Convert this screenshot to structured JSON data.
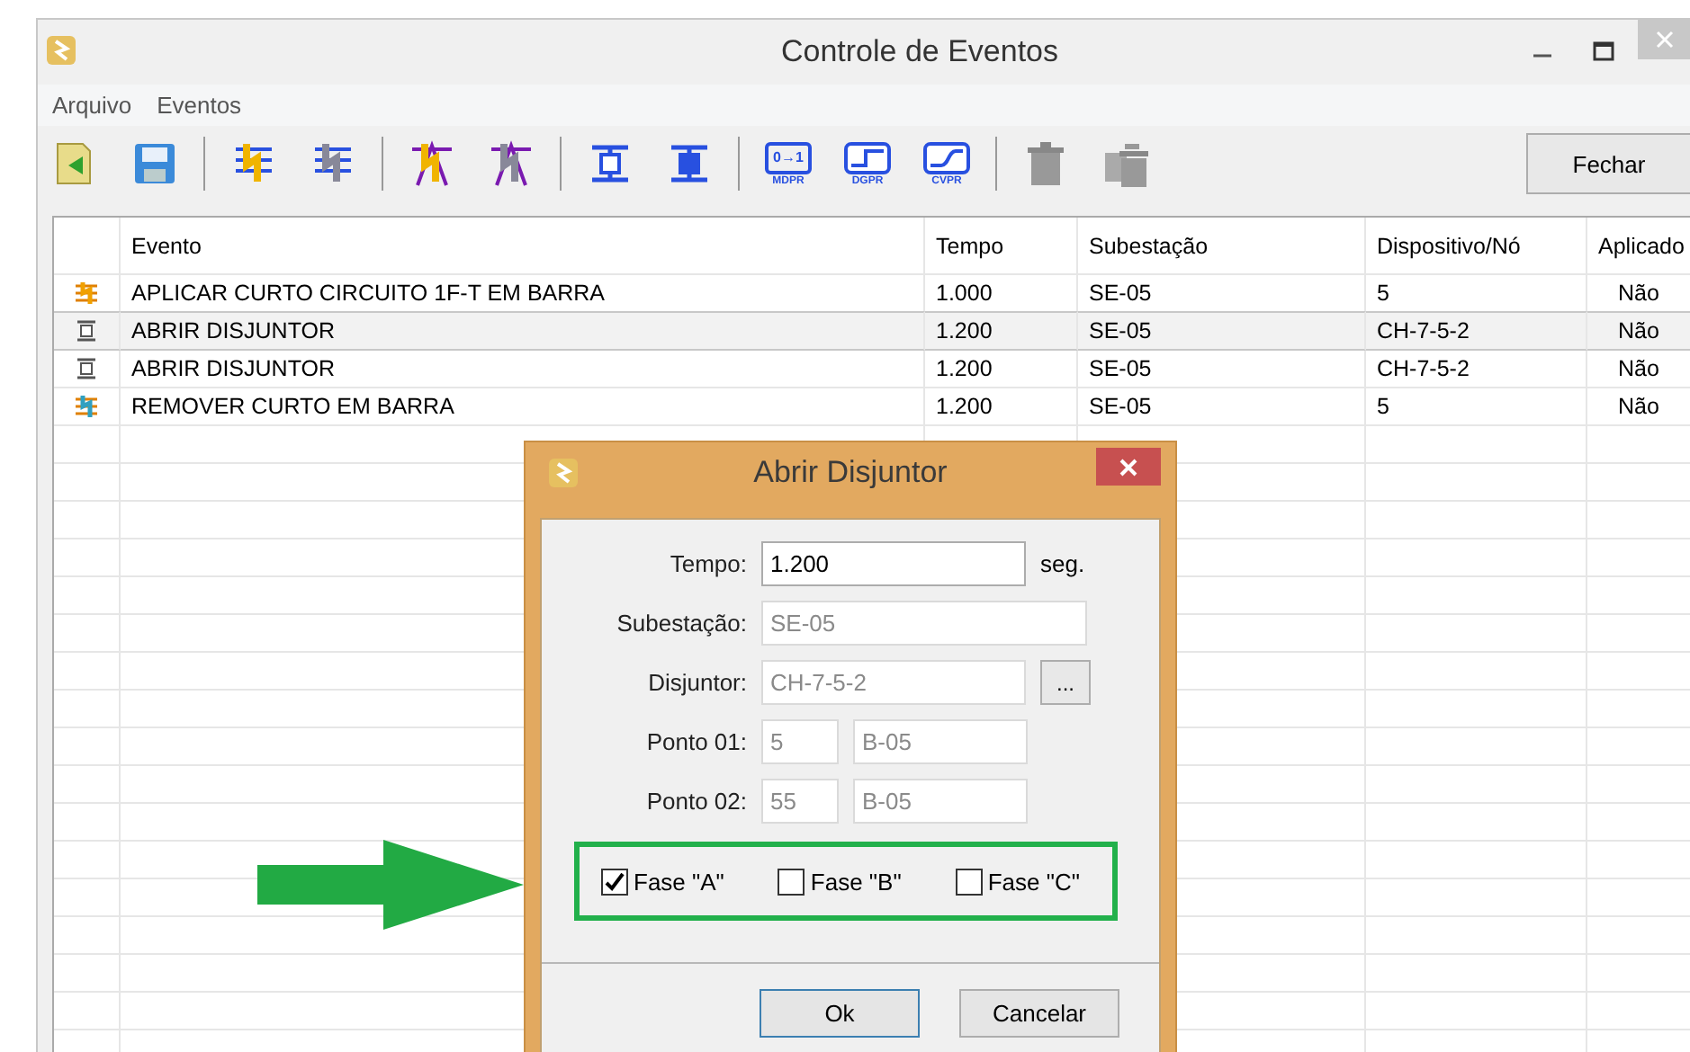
{
  "window": {
    "title": "Controle de Eventos"
  },
  "menu": [
    {
      "label": "Arquivo"
    },
    {
      "label": "Eventos"
    }
  ],
  "toolbar": [
    {
      "kind": "open"
    },
    {
      "kind": "save"
    },
    {
      "kind": "sep"
    },
    {
      "kind": "fault-list"
    },
    {
      "kind": "fault-list-gray"
    },
    {
      "kind": "sep"
    },
    {
      "kind": "tower"
    },
    {
      "kind": "tower-gray"
    },
    {
      "kind": "sep"
    },
    {
      "kind": "breaker"
    },
    {
      "kind": "breaker-blue"
    },
    {
      "kind": "sep"
    },
    {
      "kind": "relay",
      "glyph": "0→1",
      "caption": "MDPR"
    },
    {
      "kind": "step",
      "caption": "DGPR"
    },
    {
      "kind": "curve",
      "caption": "CVPR"
    },
    {
      "kind": "sep"
    },
    {
      "kind": "trash"
    },
    {
      "kind": "trash-many"
    }
  ],
  "close_button": "Fechar",
  "table": {
    "columns": [
      "Evento",
      "Tempo",
      "Subestação",
      "Dispositivo/Nó",
      "Aplicado"
    ],
    "rows": [
      {
        "kind": "fault-apply",
        "selected": false,
        "cells": [
          "APLICAR CURTO CIRCUITO 1F-T EM BARRA",
          "1.000",
          "SE-05",
          "5",
          "Não"
        ]
      },
      {
        "kind": "breaker",
        "selected": true,
        "cells": [
          "ABRIR DISJUNTOR",
          "1.200",
          "SE-05",
          "CH-7-5-2",
          "Não"
        ]
      },
      {
        "kind": "breaker",
        "selected": false,
        "cells": [
          "ABRIR DISJUNTOR",
          "1.200",
          "SE-05",
          "CH-7-5-2",
          "Não"
        ]
      },
      {
        "kind": "fault-remove",
        "selected": false,
        "cells": [
          "REMOVER CURTO EM BARRA",
          "1.200",
          "SE-05",
          "5",
          "Não"
        ]
      }
    ]
  },
  "dialog": {
    "title": "Abrir Disjuntor",
    "fields": [
      {
        "label": "Tempo:",
        "kind": "unit",
        "disabled": false,
        "values": [
          "1.200"
        ],
        "unit": "seg."
      },
      {
        "label": "Subestação:",
        "kind": "wide",
        "disabled": true,
        "values": [
          "SE-05"
        ]
      },
      {
        "label": "Disjuntor:",
        "kind": "browse",
        "disabled": true,
        "values": [
          "CH-7-5-2"
        ],
        "button": "..."
      },
      {
        "label": "Ponto 01:",
        "kind": "pair",
        "disabled": true,
        "values": [
          "5",
          "B-05"
        ]
      },
      {
        "label": "Ponto 02:",
        "kind": "pair",
        "disabled": true,
        "values": [
          "55",
          "B-05"
        ]
      }
    ],
    "phases": [
      {
        "label": "Fase \"A\"",
        "checked": true
      },
      {
        "label": "Fase \"B\"",
        "checked": false
      },
      {
        "label": "Fase \"C\"",
        "checked": false
      }
    ],
    "buttons": [
      {
        "label": "Ok",
        "default": true
      },
      {
        "label": "Cancelar",
        "default": false
      }
    ]
  }
}
